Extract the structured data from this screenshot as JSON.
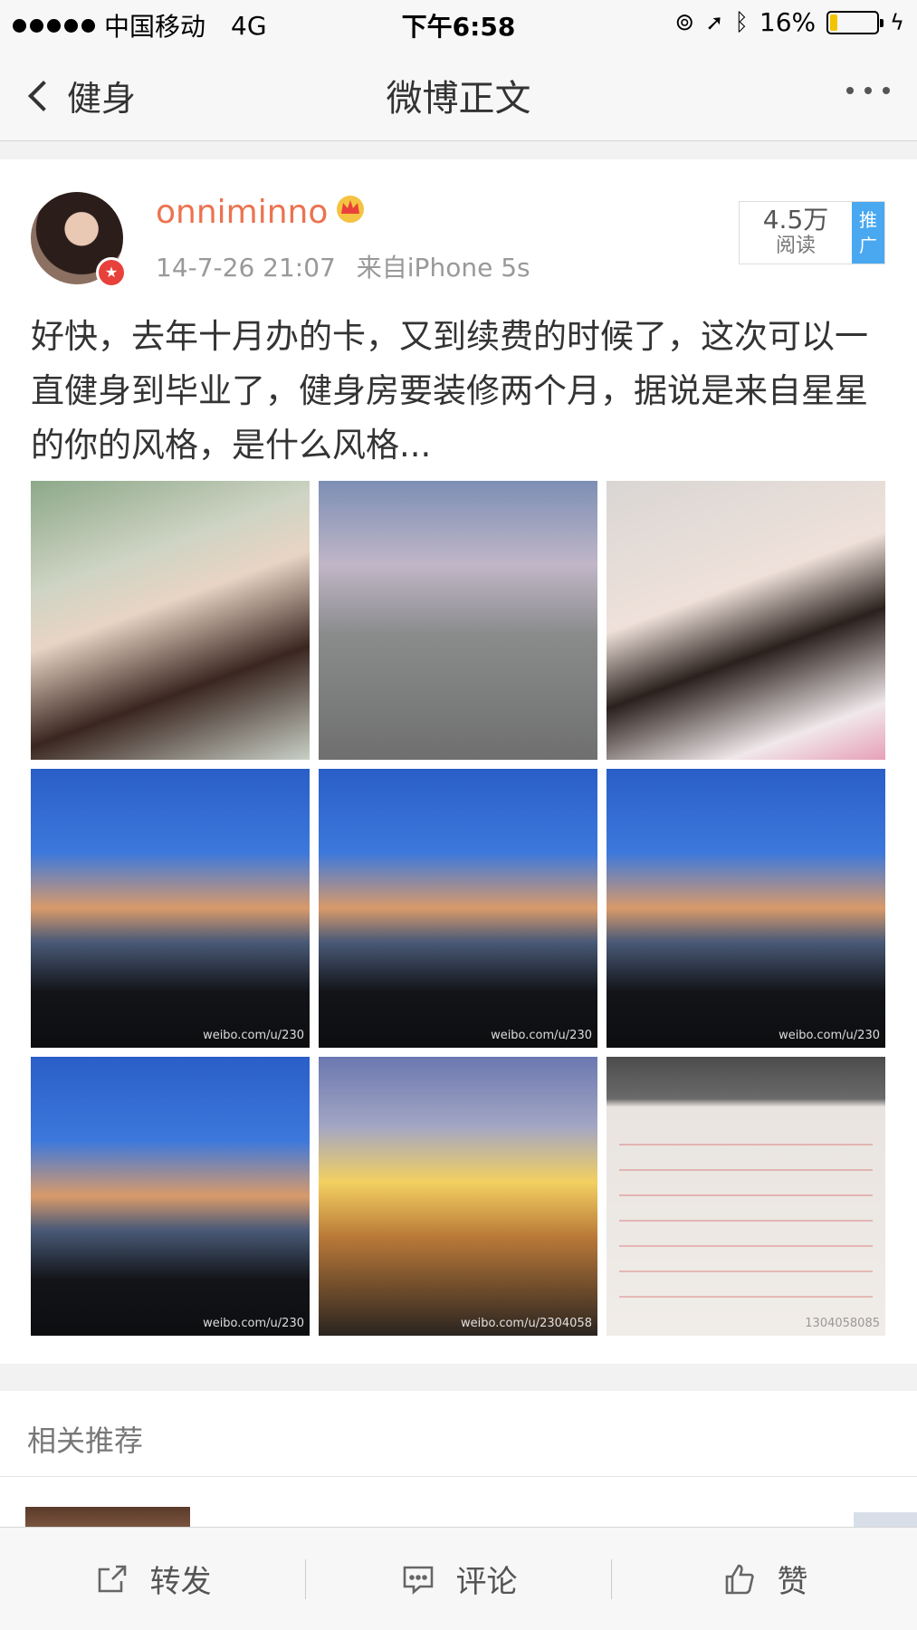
{
  "status_bar": {
    "carrier": "中国移动",
    "network": "4G",
    "time": "下午6:58",
    "battery": "16%",
    "battery_level": 0.16
  },
  "nav": {
    "back_label": "健身",
    "title": "微博正文"
  },
  "post": {
    "username": "onniminno",
    "timestamp": "14-7-26 21:07",
    "source": "来自iPhone 5s",
    "reads_count": "4.5万",
    "reads_label": "阅读",
    "promote_label": "推广",
    "text": "好快，去年十月办的卡，又到续费的时候了，这次可以一直健身到毕业了，健身房要装修两个月，据说是来自星星的你的风格，是什么风格...",
    "photos": [
      {
        "kind": "selfie",
        "watermark": ""
      },
      {
        "kind": "standing-photo",
        "watermark": ""
      },
      {
        "kind": "selfie",
        "watermark": ""
      },
      {
        "kind": "sunset-sky",
        "watermark": "weibo.com/u/230"
      },
      {
        "kind": "sunset-sky",
        "watermark": "weibo.com/u/230"
      },
      {
        "kind": "sunset-sky",
        "watermark": "weibo.com/u/230"
      },
      {
        "kind": "sunset-sky",
        "watermark": "weibo.com/u/230"
      },
      {
        "kind": "street-lights",
        "watermark": "weibo.com/u/2304058"
      },
      {
        "kind": "gym-card-document",
        "watermark": "1304058085"
      }
    ]
  },
  "related": {
    "title": "相关推荐"
  },
  "toolbar": {
    "repost": "转发",
    "comment": "评论",
    "like": "赞"
  }
}
